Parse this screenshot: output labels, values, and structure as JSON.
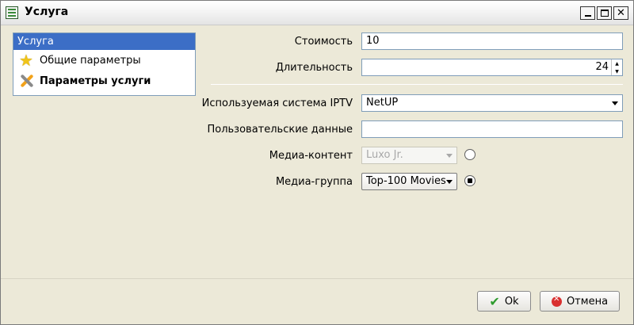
{
  "window": {
    "title": "Услуга"
  },
  "sidebar": {
    "header": "Услуга",
    "items": [
      {
        "label": "Общие параметры",
        "icon": "star-icon"
      },
      {
        "label": "Параметры услуги",
        "icon": "tools-icon"
      }
    ]
  },
  "form": {
    "cost": {
      "label": "Стоимость",
      "value": "10"
    },
    "duration": {
      "label": "Длительность",
      "value": "24"
    },
    "iptv": {
      "label": "Используемая система IPTV",
      "value": "NetUP"
    },
    "user_data": {
      "label": "Пользовательские данные",
      "value": ""
    },
    "media_content": {
      "label": "Медиа-контент",
      "value": "Luxo Jr."
    },
    "media_group": {
      "label": "Медиа-группа",
      "value": "Top-100 Movies"
    }
  },
  "buttons": {
    "ok": "Ok",
    "cancel": "Отмена"
  }
}
